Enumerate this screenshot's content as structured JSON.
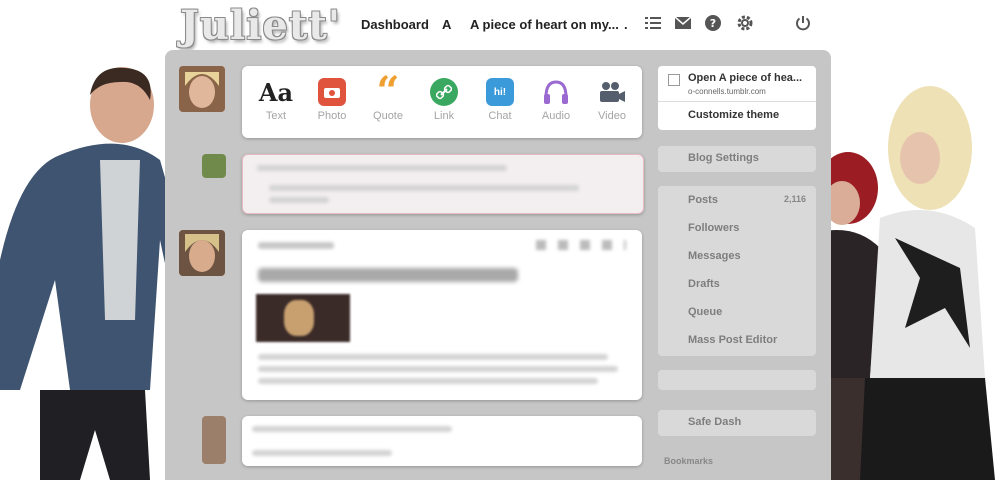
{
  "logo": "Juliett'",
  "nav": {
    "dashboard": "Dashboard",
    "a": "A",
    "blog": "A piece of heart on my...",
    "dot": "."
  },
  "icons": [
    "list-icon",
    "mail-icon",
    "help-icon",
    "gear-icon",
    "power-icon"
  ],
  "post_types": [
    {
      "label": "Text",
      "glyph": "Aa",
      "color": "#222222"
    },
    {
      "label": "Photo",
      "glyph": "",
      "color": "#e0533c"
    },
    {
      "label": "Quote",
      "glyph": "“",
      "color": "#f0a030"
    },
    {
      "label": "Link",
      "glyph": "",
      "color": "#3aa860"
    },
    {
      "label": "Chat",
      "glyph": "hi!",
      "color": "#3b9ad9"
    },
    {
      "label": "Audio",
      "glyph": "",
      "color": "#9b6ad0"
    },
    {
      "label": "Video",
      "glyph": "",
      "color": "#555e6c"
    }
  ],
  "post": {
    "date": "2013.02.25 21:13",
    "title": "Is anyone okay with adopting me ?"
  },
  "sidebar": {
    "open_title": "Open A piece of hea...",
    "open_sub": "o-connells.tumblr.com",
    "customize": "Customize theme",
    "blog_settings": "Blog Settings",
    "posts_label": "Posts",
    "posts_count": "2,116",
    "followers": "Followers",
    "messages": "Messages",
    "drafts": "Drafts",
    "queue": "Queue",
    "mass_editor": "Mass Post Editor",
    "safe_dash": "Safe Dash",
    "bookmarks": "Bookmarks"
  }
}
